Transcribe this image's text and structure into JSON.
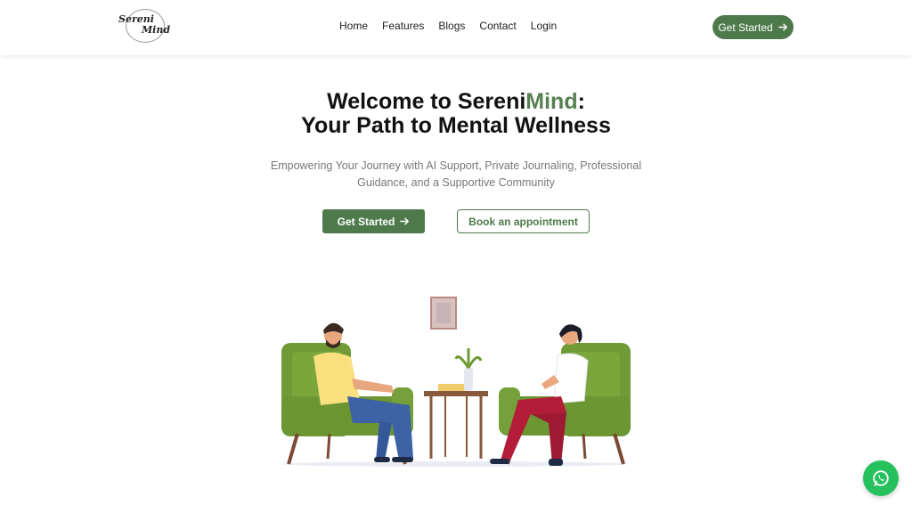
{
  "logo": {
    "line1": "Sereni",
    "line2": "Mind"
  },
  "nav": {
    "links": [
      "Home",
      "Features",
      "Blogs",
      "Contact",
      "Login"
    ],
    "cta_label": "Get Started"
  },
  "hero": {
    "title_prefix": "Welcome to Sereni",
    "title_accent": "Mind",
    "title_suffix": ":",
    "title_line2": "Your Path to Mental Wellness",
    "subtitle": "Empowering Your Journey with AI Support, Private Journaling, Professional Guidance, and a Supportive Community",
    "primary_button": "Get Started",
    "secondary_button": "Book an appointment"
  },
  "colors": {
    "brand_green": "#4e7a4b",
    "accent_green": "#56804f",
    "whatsapp_green": "#25c15c"
  },
  "icons": {
    "cta_icon": "arrow-right-icon",
    "float_icon": "whatsapp-icon"
  }
}
